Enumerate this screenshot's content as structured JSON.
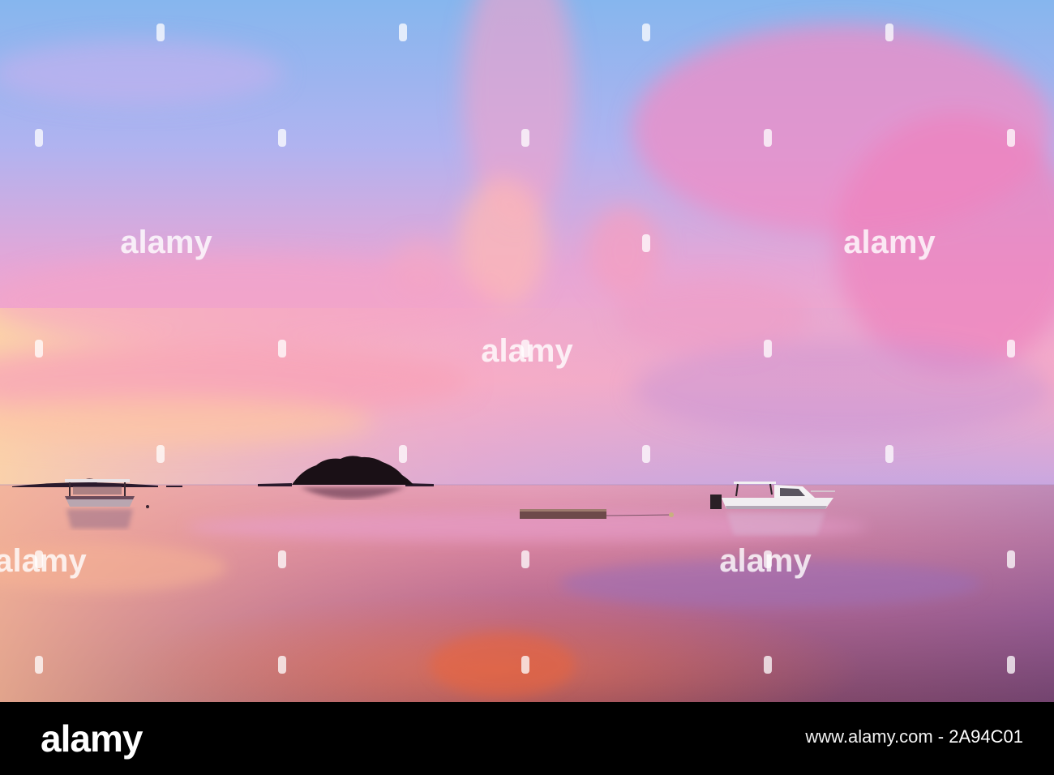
{
  "watermark": {
    "text": "alamy"
  },
  "footer": {
    "brand": "alamy",
    "ref_label": "www.alamy.com",
    "ref_sep": " - ",
    "image_id": "2A94C01"
  },
  "scene": {
    "sky_colors": [
      "#86b6ee",
      "#b7a6ee",
      "#e79ad8",
      "#f7a8c8",
      "#fbc7a9"
    ],
    "sea_colors": [
      "#f3b2a0",
      "#d9809f",
      "#b6658f",
      "#94506f",
      "#6f3752"
    ]
  }
}
